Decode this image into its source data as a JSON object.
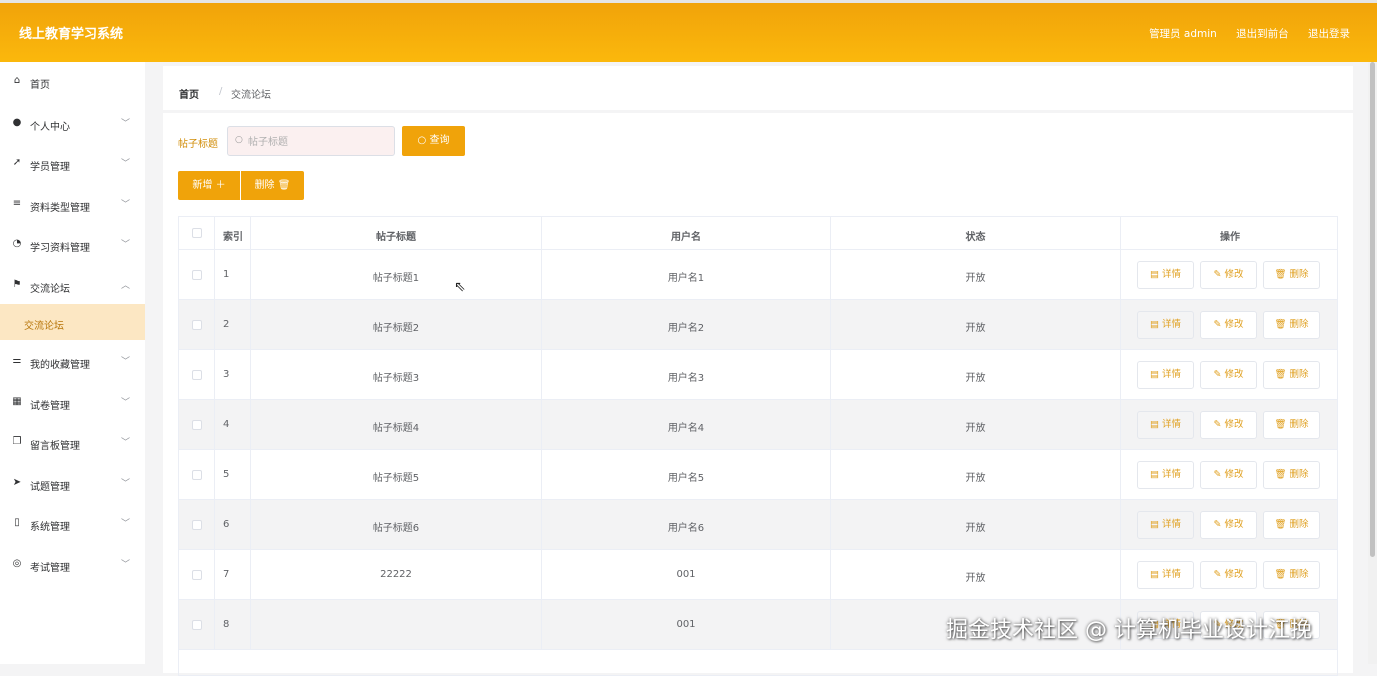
{
  "header": {
    "title": "线上教育学习系统",
    "user": "管理员 admin",
    "to_front": "退出到前台",
    "logout": "退出登录"
  },
  "sidebar": {
    "items": [
      {
        "label": "首页",
        "icon": "home-icon",
        "glyph": "⌂"
      },
      {
        "label": "个人中心",
        "icon": "user-icon",
        "glyph": "●"
      },
      {
        "label": "学员管理",
        "icon": "send-icon",
        "glyph": "➚"
      },
      {
        "label": "资料类型管理",
        "icon": "menu-icon",
        "glyph": "≡"
      },
      {
        "label": "学习资料管理",
        "icon": "dashboard-icon",
        "glyph": "◔"
      },
      {
        "label": "交流论坛",
        "icon": "flag-icon",
        "glyph": "⚑"
      },
      {
        "label": "我的收藏管理",
        "icon": "sliders-icon",
        "glyph": "⚌"
      },
      {
        "label": "试卷管理",
        "icon": "grid-icon",
        "glyph": "▦"
      },
      {
        "label": "留言板管理",
        "icon": "copy-icon",
        "glyph": "❐"
      },
      {
        "label": "试题管理",
        "icon": "plane-icon",
        "glyph": "➤"
      },
      {
        "label": "系统管理",
        "icon": "phone-icon",
        "glyph": "▯"
      },
      {
        "label": "考试管理",
        "icon": "compass-icon",
        "glyph": "◎"
      }
    ],
    "sub_active": "交流论坛"
  },
  "breadcrumb": {
    "home": "首页",
    "sep": "/",
    "current": "交流论坛"
  },
  "search": {
    "label": "帖子标题",
    "placeholder": "帖子标题",
    "button": "查询"
  },
  "actions": {
    "add": "新增 ＋",
    "delete": "删除 🗑"
  },
  "table": {
    "headers": [
      "索引",
      "帖子标题",
      "用户名",
      "状态",
      "操作"
    ],
    "op_labels": {
      "detail": "▤ 详情",
      "edit": "✎ 修改",
      "delete": "🗑 删除"
    },
    "rows": [
      {
        "index": "1",
        "title": "帖子标题1",
        "user": "用户名1",
        "status": "开放"
      },
      {
        "index": "2",
        "title": "帖子标题2",
        "user": "用户名2",
        "status": "开放"
      },
      {
        "index": "3",
        "title": "帖子标题3",
        "user": "用户名3",
        "status": "开放"
      },
      {
        "index": "4",
        "title": "帖子标题4",
        "user": "用户名4",
        "status": "开放"
      },
      {
        "index": "5",
        "title": "帖子标题5",
        "user": "用户名5",
        "status": "开放"
      },
      {
        "index": "6",
        "title": "帖子标题6",
        "user": "用户名6",
        "status": "开放"
      },
      {
        "index": "7",
        "title": "22222",
        "user": "001",
        "status": "开放"
      },
      {
        "index": "8",
        "title": "",
        "user": "001",
        "status": ""
      }
    ]
  },
  "watermark": "掘金技术社区 @ 计算机毕业设计江挽",
  "colors": {
    "accent": "#f0a30a",
    "header": "#fbb80c",
    "active_bg": "#fce7c3"
  }
}
